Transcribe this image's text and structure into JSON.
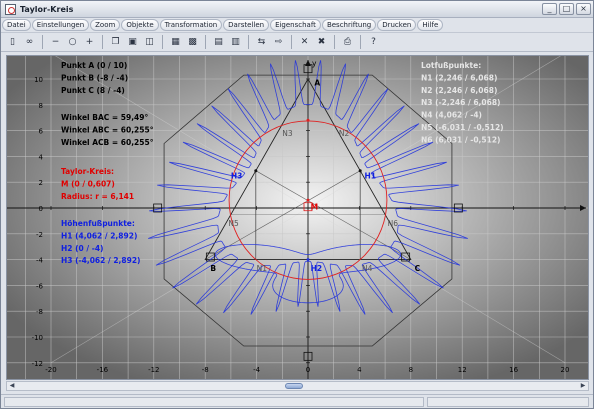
{
  "window": {
    "title": "Taylor-Kreis",
    "controls": [
      "_",
      "□",
      "×"
    ]
  },
  "menu": [
    "Datei",
    "Einstellungen",
    "Zoom",
    "Objekte",
    "Transformation",
    "Darstellen",
    "Eigenschaft",
    "Beschriftung",
    "Drucken",
    "Hilfe"
  ],
  "toolbar": {
    "buttons": [
      {
        "name": "calculator-icon",
        "glyph": "▯"
      },
      {
        "name": "glasses-icon",
        "glyph": "∞"
      },
      {
        "name": "zoom-out-icon",
        "glyph": "−"
      },
      {
        "name": "zoom-icon",
        "glyph": "○"
      },
      {
        "name": "zoom-in-icon",
        "glyph": "+"
      },
      {
        "name": "copy-icon",
        "glyph": "❐"
      },
      {
        "name": "window-icon",
        "glyph": "▣"
      },
      {
        "name": "frame-icon",
        "glyph": "◫"
      },
      {
        "name": "grid-icon",
        "glyph": "▦"
      },
      {
        "name": "grid-fine-icon",
        "glyph": "▩"
      },
      {
        "name": "table-icon",
        "glyph": "▤"
      },
      {
        "name": "page-icon",
        "glyph": "▥"
      },
      {
        "name": "move-icon",
        "glyph": "⇆"
      },
      {
        "name": "export-icon",
        "glyph": "⇨"
      },
      {
        "name": "cross-icon",
        "glyph": "✕"
      },
      {
        "name": "cross-box-icon",
        "glyph": "✖"
      },
      {
        "name": "print-icon",
        "glyph": "⎙"
      },
      {
        "name": "help-icon",
        "glyph": "?"
      }
    ]
  },
  "plot": {
    "axis_y_label": "y",
    "x_ticks": [
      -20,
      -16,
      -12,
      -8,
      -4,
      0,
      4,
      8,
      12,
      16,
      20
    ],
    "y_ticks": [
      12,
      10,
      8,
      6,
      4,
      2,
      0,
      -2,
      -4,
      -6,
      -8,
      -10,
      -12
    ],
    "points_info": [
      "Punkt A (0 / 10)",
      "Punkt B (-8 / -4)",
      "Punkt C (8 / -4)"
    ],
    "angles_info": [
      "Winkel BAC = 59,49°",
      "Winkel ABC = 60,255°",
      "Winkel ACB = 60,255°"
    ],
    "taylor_info": [
      "Taylor-Kreis:",
      "M (0 / 0,607)",
      "Radius: r = 6,141"
    ],
    "hoehen_info": [
      "Höhenfußpunkte:",
      "H1 (4,062 / 2,892)",
      "H2 (0 / -4)",
      "H3 (-4,062 / 2,892)"
    ],
    "lotfuss_info": [
      "Lotfußpunkte:",
      "N1 (2,246 / 6,068)",
      "N2 (2,246 / 6,068)",
      "N3 (-2,246 / 6,068)",
      "N4 (4,062 / -4)",
      "N5 (-6,031 / -0,512)",
      "N6 (6,031 / -0,512)"
    ],
    "labels": {
      "A": "A",
      "B": "B",
      "C": "C",
      "M": "M",
      "H1": "H1",
      "H2": "H2",
      "H3": "H3",
      "N1": "N1",
      "N2": "N2",
      "N3": "N3",
      "N4": "N4",
      "N5": "N5",
      "N6": "N6"
    },
    "colors": {
      "background_center": "#f4f4f4",
      "background_edge": "#666666",
      "triangle": "#222222",
      "circle": "#e02020",
      "curve": "#2233dd",
      "text_black": "#000000",
      "text_red": "#e00000",
      "text_blue": "#1020e0",
      "text_faint": "#e6e6e6"
    },
    "triangle": {
      "A": [
        0,
        10
      ],
      "B": [
        -8,
        -4
      ],
      "C": [
        8,
        -4
      ]
    },
    "circle": {
      "center": [
        0,
        0.607
      ],
      "radius": 6.141
    },
    "foot_points": {
      "H1": [
        4.062,
        2.892
      ],
      "H2": [
        0,
        -4
      ],
      "H3": [
        -4.062,
        2.892
      ]
    },
    "lot_points": {
      "N1": [
        2.246,
        6.068
      ],
      "N3": [
        -2.246,
        6.068
      ],
      "N4": [
        -4.062,
        -4
      ],
      "N5": [
        -6.031,
        -0.512
      ],
      "N6": [
        6.031,
        -0.512
      ]
    }
  }
}
